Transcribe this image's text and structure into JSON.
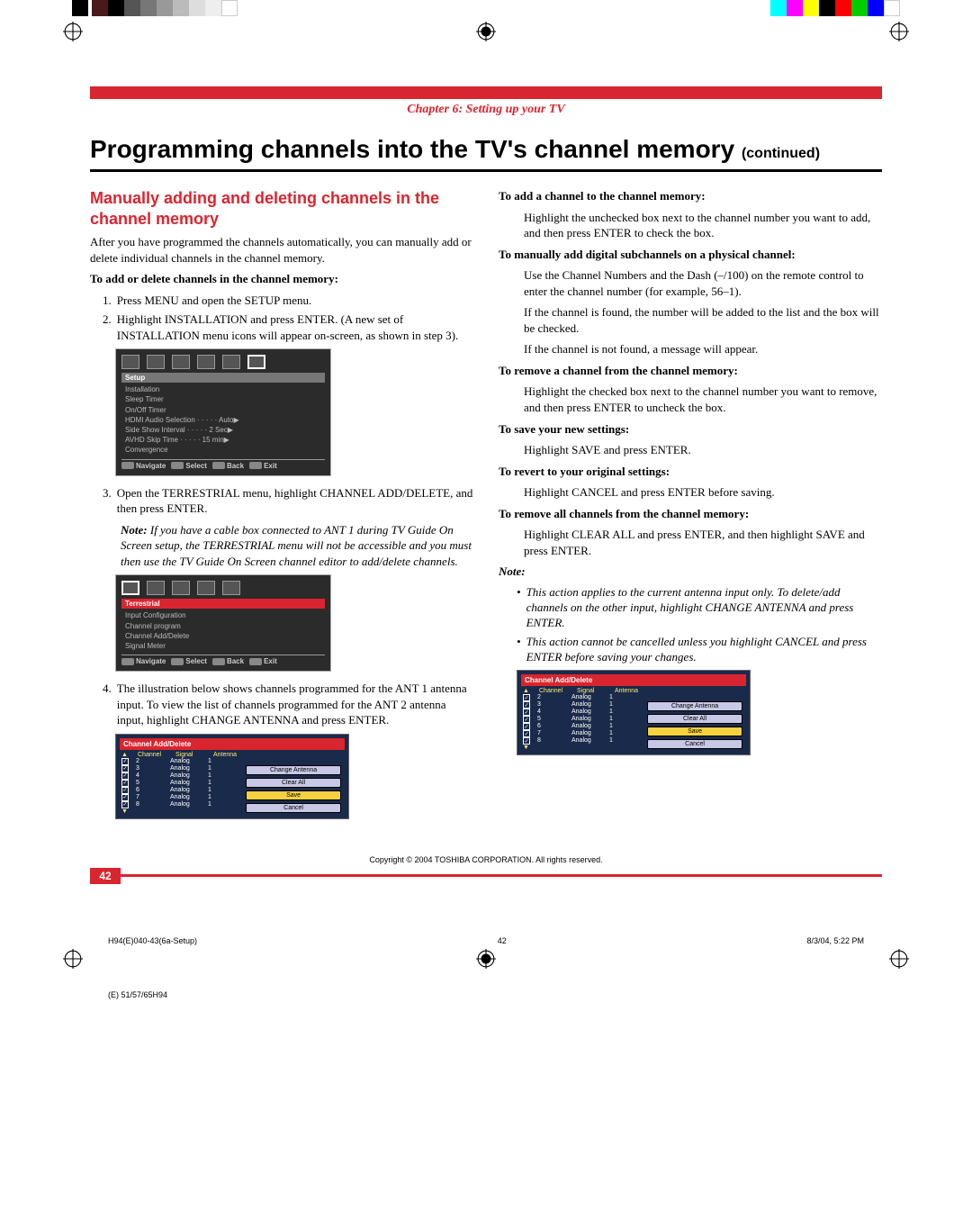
{
  "chapter": "Chapter 6: Setting up your TV",
  "title_main": "Programming channels into the TV's channel memory ",
  "title_cont": "(continued)",
  "left": {
    "subhead": "Manually adding and deleting channels in the channel memory",
    "intro": "After you have programmed the channels automatically, you can manually add or delete individual channels in the channel memory.",
    "howto_head": "To add or delete channels in the channel memory:",
    "step1_n": "1.",
    "step1": "Press MENU and open the SETUP menu.",
    "step2_n": "2.",
    "step2": "Highlight INSTALLATION and press ENTER. (A new set of INSTALLATION menu icons will appear on-screen, as shown in step 3).",
    "step3_n": "3.",
    "step3": "Open the TERRESTRIAL menu, highlight CHANNEL ADD/DELETE, and then press ENTER.",
    "note_lbl": "Note: ",
    "note_txt": "If you have a cable box connected to ANT 1 during TV Guide On Screen setup, the TERRESTRIAL menu will not be accessible and you must then use the TV Guide On Screen channel editor to add/delete channels.",
    "step4_n": "4.",
    "step4": "The illustration below shows channels programmed for the ANT 1 antenna input. To view the list of channels programmed for the ANT 2 antenna input, highlight CHANGE ANTENNA and press ENTER."
  },
  "right": {
    "add_h": "To add a channel to the channel memory:",
    "add_t": "Highlight the unchecked box next to the channel number you want to add, and then press ENTER to check the box.",
    "sub_h": "To manually add digital subchannels on a physical channel:",
    "sub_t1": "Use the Channel Numbers and the Dash (–/100) on the remote control to enter the channel number (for example, 56–1).",
    "sub_t2": "If the channel is found, the number will be added to the list and the box will be checked.",
    "sub_t3": "If the channel is not found, a message will appear.",
    "rem_h": "To remove a channel from the channel memory:",
    "rem_t": "Highlight the checked box next to the channel number you want to remove, and then press ENTER to uncheck the box.",
    "save_h": "To save your new settings:",
    "save_t": "Highlight SAVE and press ENTER.",
    "rev_h": "To revert to your original settings:",
    "rev_t": "Highlight CANCEL and press ENTER before saving.",
    "all_h": "To remove all channels from the channel memory:",
    "all_t": "Highlight CLEAR ALL and press ENTER, and then highlight SAVE and press ENTER.",
    "note_h": "Note:",
    "b1": "This action applies to the current antenna input only. To delete/add channels on the other input, highlight CHANGE ANTENNA and press ENTER.",
    "b2": "This action cannot be cancelled unless you highlight CANCEL and press ENTER before saving your changes."
  },
  "osd1": {
    "title": "Setup",
    "items": [
      "Installation",
      "Sleep Timer",
      "On/Off Timer",
      "HDMI Audio Selection · · · · · Auto▶",
      "Side Show Interval · · · · · 2 Sec▶",
      "AVHD Skip Time · · · · · 15 min▶",
      "Convergence"
    ],
    "nav": [
      "Navigate",
      "Select",
      "Back",
      "Exit"
    ]
  },
  "osd2": {
    "title": "Terrestrial",
    "items": [
      "Input Configuration",
      "Channel program",
      "Channel Add/Delete",
      "Signal Meter"
    ],
    "nav": [
      "Navigate",
      "Select",
      "Back",
      "Exit"
    ]
  },
  "tbl": {
    "title": "Channel Add/Delete",
    "cols": [
      "Channel",
      "Signal",
      "Antenna"
    ],
    "rows": [
      {
        "ch": "2",
        "sig": "Analog",
        "ant": "1"
      },
      {
        "ch": "3",
        "sig": "Analog",
        "ant": "1"
      },
      {
        "ch": "4",
        "sig": "Analog",
        "ant": "1"
      },
      {
        "ch": "5",
        "sig": "Analog",
        "ant": "1"
      },
      {
        "ch": "6",
        "sig": "Analog",
        "ant": "1"
      },
      {
        "ch": "7",
        "sig": "Analog",
        "ant": "1"
      },
      {
        "ch": "8",
        "sig": "Analog",
        "ant": "1"
      }
    ],
    "btns": {
      "change": "Change Antenna",
      "clear": "Clear All",
      "save": "Save",
      "cancel": "Cancel"
    }
  },
  "footer": {
    "copy": "Copyright © 2004 TOSHIBA CORPORATION. All rights reserved.",
    "page": "42"
  },
  "meta": {
    "file": "H94(E)040-43(6a-Setup)",
    "pnum": "42",
    "ts": "8/3/04, 5:22 PM"
  },
  "edge": "(E) 51/57/65H94"
}
